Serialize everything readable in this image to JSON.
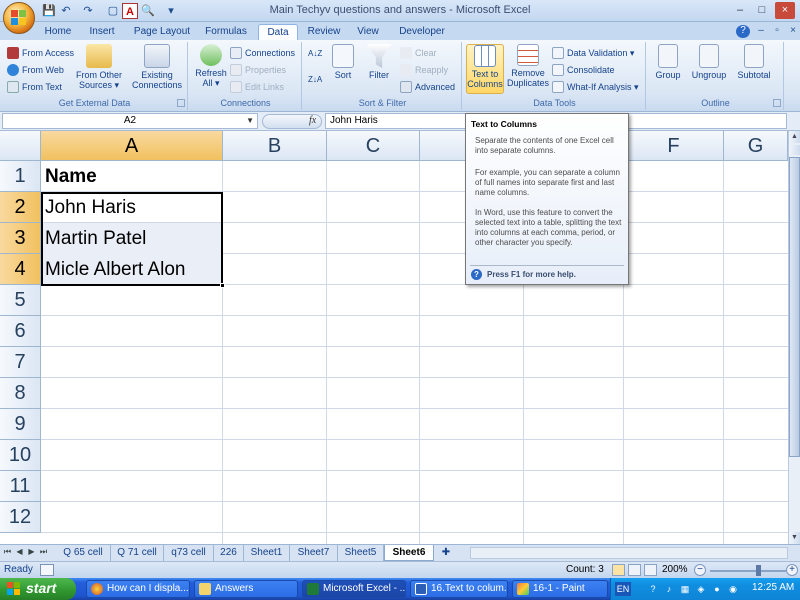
{
  "window": {
    "title": "Main Techyv questions and answers - Microsoft Excel",
    "controls": [
      "–",
      "□",
      "×"
    ]
  },
  "quick_access": [
    "💾",
    "↶",
    "↷",
    "▢",
    "A",
    "🔍",
    "▾"
  ],
  "ribbon_tabs": [
    "Home",
    "Insert",
    "Page Layout",
    "Formulas",
    "Data",
    "Review",
    "View",
    "Developer"
  ],
  "active_tab": "Data",
  "ribbon": {
    "get_external_data": {
      "label": "Get External Data",
      "from_access": "From Access",
      "from_web": "From Web",
      "from_text": "From Text",
      "from_other_1": "From Other",
      "from_other_2": "Sources ▾",
      "existing_1": "Existing",
      "existing_2": "Connections"
    },
    "connections": {
      "label": "Connections",
      "refresh_1": "Refresh",
      "refresh_2": "All ▾",
      "connections": "Connections",
      "properties": "Properties",
      "edit_links": "Edit Links"
    },
    "sort_filter": {
      "label": "Sort & Filter",
      "az": "A↓Z",
      "za": "Z↓A",
      "sort": "Sort",
      "filter": "Filter",
      "clear": "Clear",
      "reapply": "Reapply",
      "advanced": "Advanced"
    },
    "data_tools": {
      "label": "Data Tools",
      "text_to_columns_1": "Text to",
      "text_to_columns_2": "Columns",
      "remove_dup_1": "Remove",
      "remove_dup_2": "Duplicates",
      "data_validation": "Data Validation ▾",
      "consolidate": "Consolidate",
      "what_if": "What-If Analysis ▾"
    },
    "outline": {
      "label": "Outline",
      "group": "Group",
      "ungroup": "Ungroup",
      "subtotal": "Subtotal"
    }
  },
  "formula_bar": {
    "name_box": "A2",
    "fx": "fx",
    "content": "John Haris"
  },
  "grid": {
    "columns": [
      "A",
      "B",
      "C",
      "D",
      "E",
      "F",
      "G"
    ],
    "rows": [
      "1",
      "2",
      "3",
      "4",
      "5",
      "6",
      "7",
      "8",
      "9",
      "10",
      "11",
      "12"
    ],
    "cells": {
      "A1": "Name",
      "A2": "John Haris",
      "A3": "Martin Patel",
      "A4": "Micle Albert Alon"
    }
  },
  "tooltip": {
    "title": "Text to Columns",
    "p1": "Separate the contents of one Excel cell into separate columns.",
    "p2": "For example, you can separate a column of full names into separate first and last name columns.",
    "p3": "In Word, use this feature to convert the selected text into a table, splitting the text into columns at each comma, period, or other character you specify.",
    "help": "Press F1 for more help."
  },
  "sheet_tabs": [
    "Q 65 cell",
    "Q 71 cell",
    "q73 cell",
    "226",
    "Sheet1",
    "Sheet7",
    "Sheet5",
    "Sheet6"
  ],
  "active_sheet": "Sheet6",
  "status": {
    "ready": "Ready",
    "count": "Count: 3",
    "zoom": "200%",
    "minus": "−",
    "plus": "+"
  },
  "taskbar": {
    "start": "start",
    "items": [
      "How can I displa...",
      "Answers",
      "Microsoft Excel - ...",
      "16.Text to colum...",
      "16-1 - Paint"
    ],
    "active_item": "Microsoft Excel - ...",
    "tray": {
      "lang": "EN",
      "help": "?"
    },
    "clock": "12:25 AM"
  },
  "colors": {
    "accent": "#15428b",
    "selected_header": "#f1c15f",
    "taskbar_blue": "#245edb",
    "start_green": "#2f962f"
  },
  "icons": {
    "office_button": "office-logo-icon",
    "help": "help-icon",
    "tooltip_help": "help-circle-icon"
  }
}
